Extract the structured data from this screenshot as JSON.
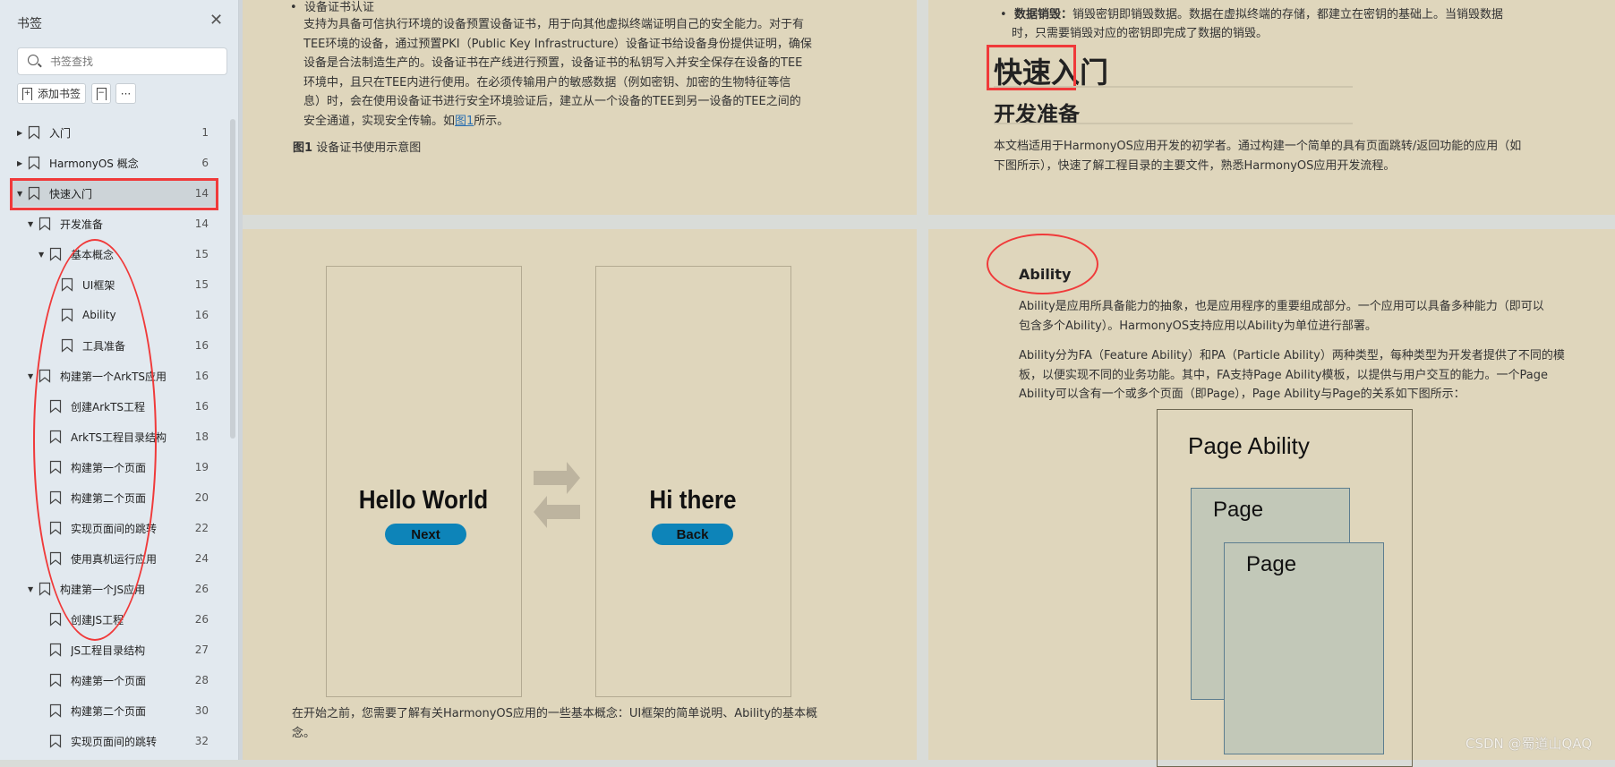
{
  "sidebar": {
    "title": "书签",
    "search_placeholder": "书签查找",
    "add_bookmark": "添加书签",
    "more": "···",
    "items": [
      {
        "label": "入门",
        "page": "1",
        "level": 0,
        "expander": "collapsed"
      },
      {
        "label": "HarmonyOS 概念",
        "page": "6",
        "level": 0,
        "expander": "collapsed"
      },
      {
        "label": "快速入门",
        "page": "14",
        "level": 0,
        "expander": "expanded",
        "selected": true
      },
      {
        "label": "开发准备",
        "page": "14",
        "level": 1,
        "expander": "expanded"
      },
      {
        "label": "基本概念",
        "page": "15",
        "level": 2,
        "expander": "expanded"
      },
      {
        "label": "UI框架",
        "page": "15",
        "level": 3
      },
      {
        "label": "Ability",
        "page": "16",
        "level": 3
      },
      {
        "label": "工具准备",
        "page": "16",
        "level": 3
      },
      {
        "label": "构建第一个ArkTS应用",
        "page": "16",
        "level": 1,
        "expander": "expanded"
      },
      {
        "label": "创建ArkTS工程",
        "page": "16",
        "level": 2
      },
      {
        "label": "ArkTS工程目录结构",
        "page": "18",
        "level": 2
      },
      {
        "label": "构建第一个页面",
        "page": "19",
        "level": 2
      },
      {
        "label": "构建第二个页面",
        "page": "20",
        "level": 2
      },
      {
        "label": "实现页面间的跳转",
        "page": "22",
        "level": 2
      },
      {
        "label": "使用真机运行应用",
        "page": "24",
        "level": 2
      },
      {
        "label": "构建第一个JS应用",
        "page": "26",
        "level": 1,
        "expander": "expanded"
      },
      {
        "label": "创建JS工程",
        "page": "26",
        "level": 2
      },
      {
        "label": "JS工程目录结构",
        "page": "27",
        "level": 2
      },
      {
        "label": "构建第一个页面",
        "page": "28",
        "level": 2
      },
      {
        "label": "构建第二个页面",
        "page": "30",
        "level": 2
      },
      {
        "label": "实现页面间的跳转",
        "page": "32",
        "level": 2
      }
    ]
  },
  "page_a_top": {
    "bullet": "设备证书认证",
    "lines": [
      "支持为具备可信执行环境的设备预置设备证书，用于向其他虚拟终端证明自己的安全能力。对于有",
      "TEE环境的设备，通过预置PKI（Public Key Infrastructure）设备证书给设备身份提供证明，确保",
      "设备是合法制造生产的。设备证书在产线进行预置，设备证书的私钥写入并安全保存在设备的TEE",
      "环境中，且只在TEE内进行使用。在必须传输用户的敏感数据（例如密钥、加密的生物特征等信",
      "息）时，会在使用设备证书进行安全环境验证后，建立从一个设备的TEE到另一设备的TEE之间的"
    ],
    "last_line_prefix": "安全通道，实现安全传输。如",
    "link": "图1",
    "last_line_suffix": "所示。",
    "figure_label": "图1",
    "figure_caption": "设备证书使用示意图"
  },
  "page_b_top": {
    "bullet_bold": "数据销毁：",
    "bullet_line1": "销毁密钥即销毁数据。数据在虚拟终端的存储，都建立在密钥的基础上。当销毁数据",
    "bullet_line2": "时，只需要销毁对应的密钥即完成了数据的销毁。",
    "h1": "快速入门",
    "h2": "开发准备",
    "para": [
      "本文档适用于HarmonyOS应用开发的初学者。通过构建一个简单的具有页面跳转/返回功能的应用（如",
      "下图所示），快速了解工程目录的主要文件，熟悉HarmonyOS应用开发流程。"
    ]
  },
  "page_a_bottom": {
    "screen1_title": "Hello World",
    "screen1_button": "Next",
    "screen2_title": "Hi there",
    "screen2_button": "Back",
    "para": [
      "在开始之前，您需要了解有关HarmonyOS应用的一些基本概念：UI框架的简单说明、Ability的基本概",
      "念。"
    ]
  },
  "page_b_bottom": {
    "h3": "Ability",
    "para1": [
      "Ability是应用所具备能力的抽象，也是应用程序的重要组成部分。一个应用可以具备多种能力（即可以",
      "包含多个Ability）。HarmonyOS支持应用以Ability为单位进行部署。"
    ],
    "para2": [
      "Ability分为FA（Feature Ability）和PA（Particle Ability）两种类型，每种类型为开发者提供了不同的模",
      "板，以便实现不同的业务功能。其中，FA支持Page Ability模板，以提供与用户交互的能力。一个Page",
      "Ability可以含有一个或多个页面（即Page），Page Ability与Page的关系如下图所示："
    ],
    "diagram_outer": "Page Ability",
    "diagram_page1": "Page",
    "diagram_page2": "Page"
  },
  "watermark": "CSDN @蜀道山QAQ",
  "colors": {
    "annotation": "#f03a3a",
    "button_blue": "#0d84b9",
    "page_bg": "#dfd6bc"
  }
}
